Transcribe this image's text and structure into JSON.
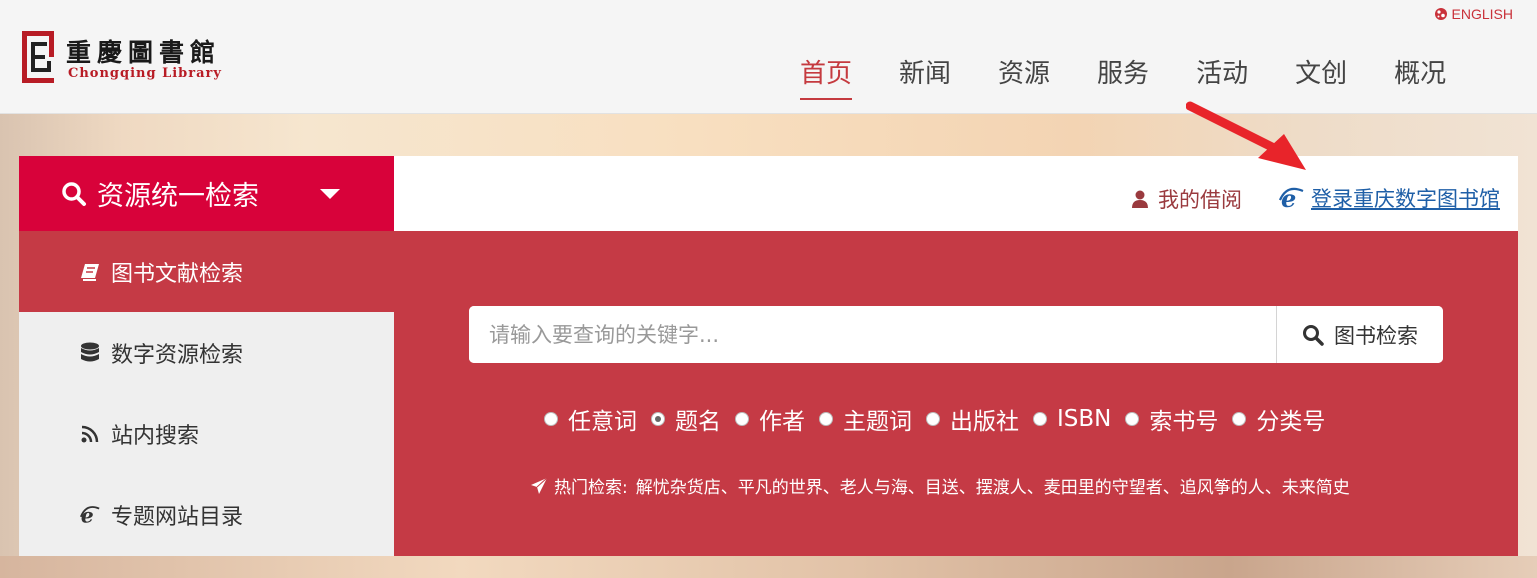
{
  "header": {
    "logo": {
      "cn": "重慶圖書館",
      "en": "Chongqing Library"
    },
    "language_link": "ENGLISH",
    "nav": [
      {
        "label": "首页",
        "active": true
      },
      {
        "label": "新闻"
      },
      {
        "label": "资源"
      },
      {
        "label": "服务"
      },
      {
        "label": "活动"
      },
      {
        "label": "文创"
      },
      {
        "label": "概况"
      }
    ]
  },
  "sidebar": {
    "title": "资源统一检索",
    "items": [
      {
        "label": "图书文献检索",
        "icon": "book-icon",
        "active": true
      },
      {
        "label": "数字资源检索",
        "icon": "database-icon"
      },
      {
        "label": "站内搜索",
        "icon": "rss-icon"
      },
      {
        "label": "专题网站目录",
        "icon": "ie-icon"
      }
    ]
  },
  "main": {
    "my_borrow": "我的借阅",
    "login_link": "登录重庆数字图书馆",
    "search": {
      "placeholder": "请输入要查询的关键字...",
      "value": "",
      "button_label": "图书检索"
    },
    "filters": [
      {
        "label": "任意词",
        "checked": false
      },
      {
        "label": "题名",
        "checked": true
      },
      {
        "label": "作者",
        "checked": false
      },
      {
        "label": "主题词",
        "checked": false
      },
      {
        "label": "出版社",
        "checked": false
      },
      {
        "label": "ISBN",
        "checked": false
      },
      {
        "label": "索书号",
        "checked": false
      },
      {
        "label": "分类号",
        "checked": false
      }
    ],
    "hot": {
      "label": "热门检索:",
      "items": [
        "解忧杂货店",
        "平凡的世界",
        "老人与海",
        "目送",
        "摆渡人",
        "麦田里的守望者",
        "追风筝的人",
        "未来简史"
      ],
      "separator": "、"
    }
  },
  "colors": {
    "brand_red": "#d8023a",
    "panel_red": "#c53a45",
    "link_blue": "#1f5fa7",
    "arrow_red": "#e8242a"
  }
}
